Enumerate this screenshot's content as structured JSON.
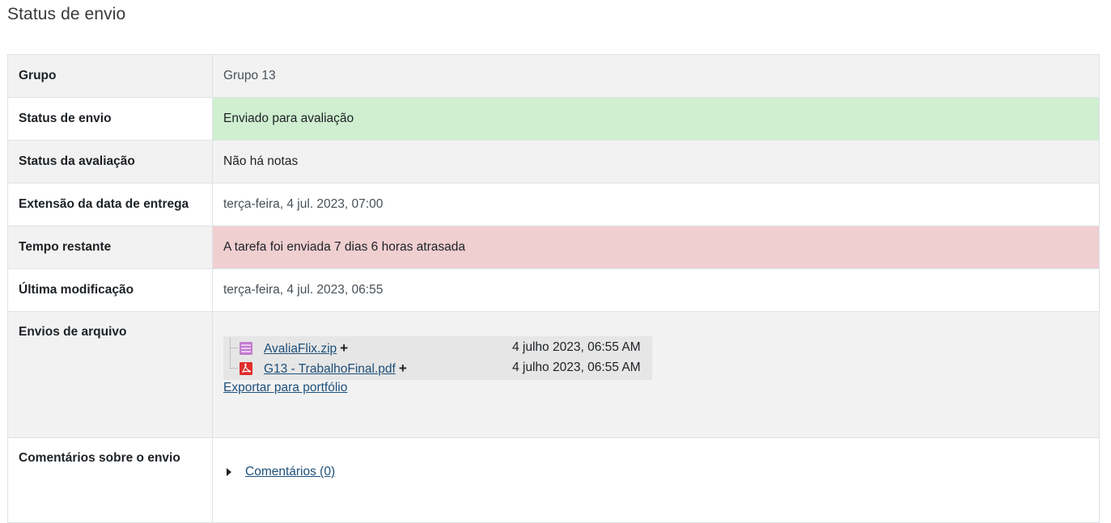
{
  "page": {
    "title": "Status de envio"
  },
  "rows": {
    "group": {
      "label": "Grupo",
      "value": "Grupo 13"
    },
    "submission_status": {
      "label": "Status de envio",
      "value": "Enviado para avaliação"
    },
    "grading_status": {
      "label": "Status da avaliação",
      "value": "Não há notas"
    },
    "due_extension": {
      "label": "Extensão da data de entrega",
      "value": "terça-feira, 4 jul. 2023, 07:00"
    },
    "time_remaining": {
      "label": "Tempo restante",
      "value": "A tarefa foi enviada 7 dias 6 horas atrasada"
    },
    "last_modified": {
      "label": "Última modificação",
      "value": "terça-feira, 4 jul. 2023, 06:55"
    },
    "file_submissions": {
      "label": "Envios de arquivo",
      "files": [
        {
          "name": "AvaliaFlix.zip",
          "date": "4 julho 2023, 06:55 AM",
          "icon": "archive-file-icon",
          "action": "+"
        },
        {
          "name": "G13 - TrabalhoFinal.pdf",
          "date": "4 julho 2023, 06:55 AM",
          "icon": "pdf-file-icon",
          "action": "+"
        }
      ],
      "export_label": "Exportar para portfólio"
    },
    "submission_comments": {
      "label": "Comentários sobre o envio",
      "link": "Comentários (0)"
    }
  },
  "colors": {
    "success_bg": "#cfefd0",
    "danger_bg": "#f0cfd1",
    "link": "#1d4f79"
  }
}
